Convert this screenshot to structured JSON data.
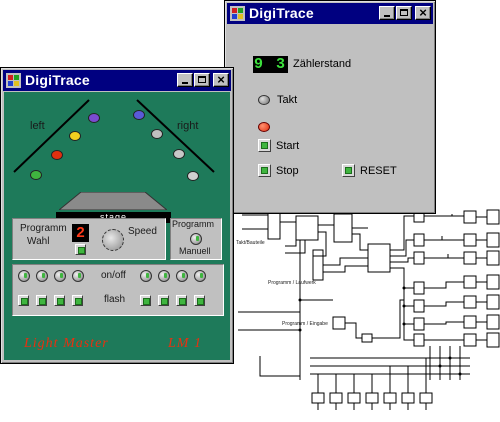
{
  "counter_window": {
    "title": "DigiTrace",
    "display_value": "9 3",
    "display_label": "Zählerstand",
    "takt_label": "Takt",
    "start_label": "Start",
    "stop_label": "Stop",
    "reset_label": "RESET"
  },
  "lightmaster_window": {
    "title": "DigiTrace",
    "left_label": "left",
    "right_label": "right",
    "stage_label": "stage",
    "programm_wahl_line1": "Programm",
    "programm_wahl_line2": "Wahl",
    "program_number": "2",
    "speed_label": "Speed",
    "programm_manuell_line1": "Programm",
    "programm_manuell_line2": "Manuell",
    "onoff_label": "on/off",
    "flash_label": "flash",
    "brand_name": "Light Master",
    "brand_model": "LM 1"
  },
  "schematic": {
    "labels": [
      "Takt/Bauteile",
      "Programm / Laufwerk",
      "Programm / Eingabe"
    ]
  },
  "colors": {
    "titlebar": "#000080",
    "lightmaster_body": "#1e7a5a",
    "lcd_green": "#3ce03c",
    "led_red": "#e03010",
    "brand_red": "#e83010"
  },
  "icons": {
    "app_icon": "digitrace-app-icon",
    "minimize": "minimize-icon",
    "maximize": "maximize-icon",
    "close": "close-icon"
  }
}
